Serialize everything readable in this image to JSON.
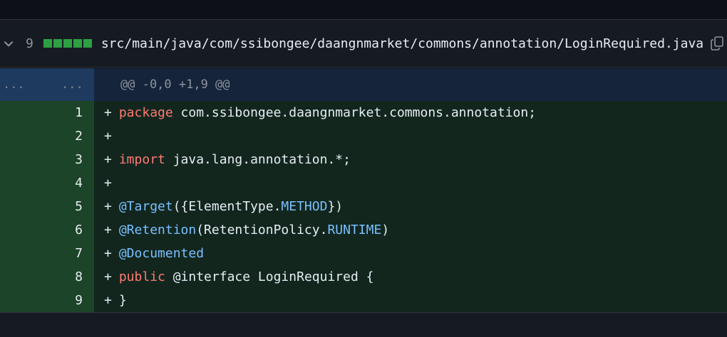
{
  "file": {
    "change_count": "9",
    "path": "src/main/java/com/ssibongee/daangnmarket/commons/annotation/LoginRequired.java",
    "diffstat_blocks": 5,
    "added_color": "#2ea043"
  },
  "hunk": {
    "old_dots": "...",
    "new_dots": "...",
    "header": "@@ -0,0 +1,9 @@"
  },
  "lines": [
    {
      "num": "1",
      "plus": "+",
      "t1": "package",
      "t2": " com.ssibongee.daangnmarket.commons.annotation;"
    },
    {
      "num": "2",
      "plus": "+"
    },
    {
      "num": "3",
      "plus": "+",
      "t1": "import",
      "t2": " java.lang.annotation.*;"
    },
    {
      "num": "4",
      "plus": "+"
    },
    {
      "num": "5",
      "plus": "+",
      "a1": "@Target",
      "t2": "({ElementType.",
      "c1": "METHOD",
      "t3": "})"
    },
    {
      "num": "6",
      "plus": "+",
      "a1": "@Retention",
      "t2": "(RetentionPolicy.",
      "c1": "RUNTIME",
      "t3": ")"
    },
    {
      "num": "7",
      "plus": "+",
      "a1": "@Documented"
    },
    {
      "num": "8",
      "plus": "+",
      "t1": "public",
      "t2": " @interface LoginRequired {"
    },
    {
      "num": "9",
      "plus": "+",
      "t2": "}"
    }
  ],
  "icons": {
    "collapse": "chevron-down-icon",
    "copy": "copy-icon"
  }
}
